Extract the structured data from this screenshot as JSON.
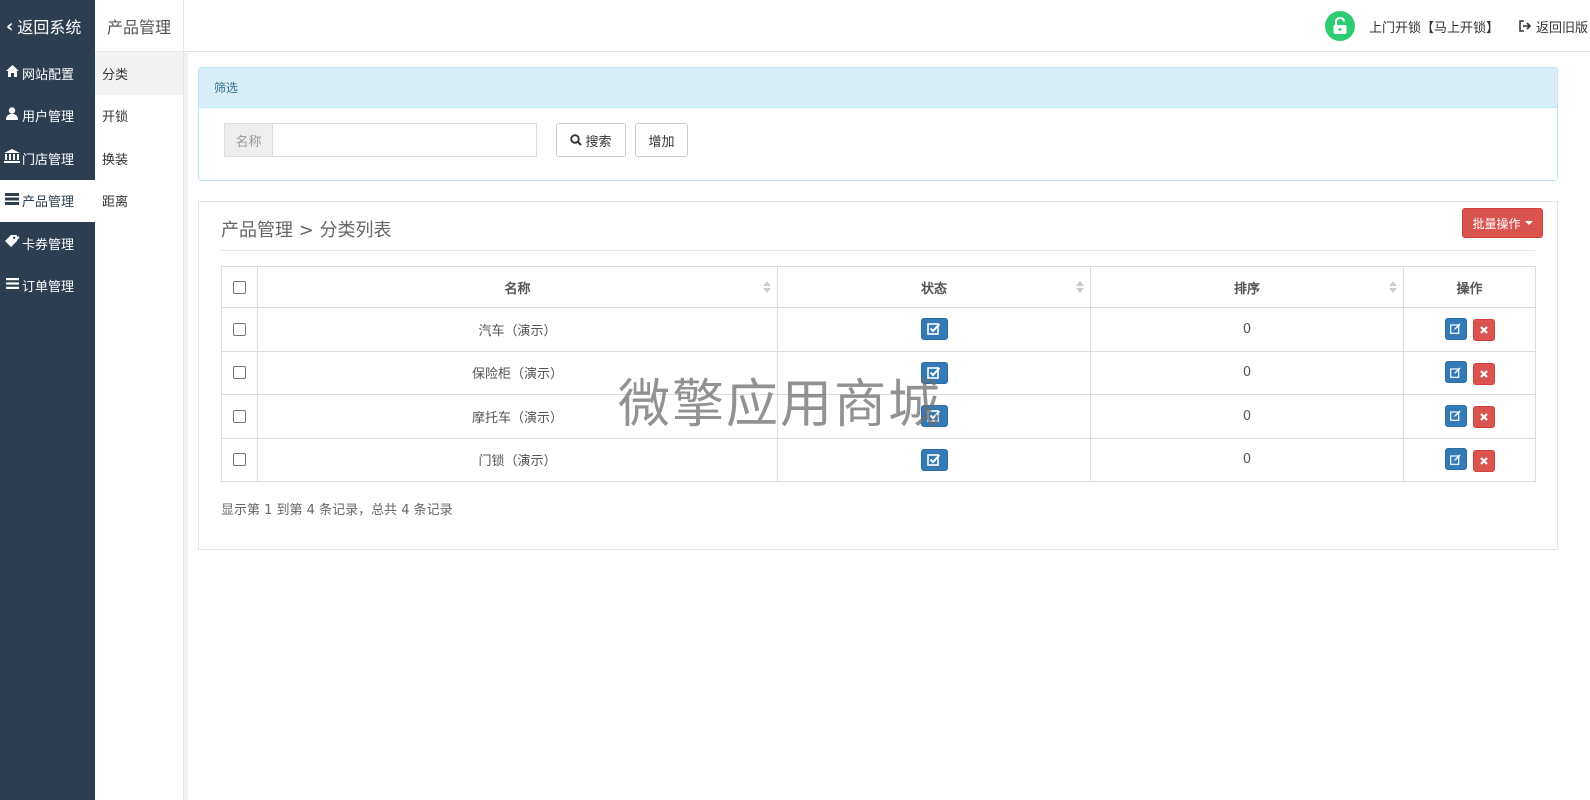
{
  "sidebar": {
    "back_label": "返回系统",
    "items": [
      {
        "label": "网站配置",
        "icon": "home-icon"
      },
      {
        "label": "用户管理",
        "icon": "user-icon"
      },
      {
        "label": "门店管理",
        "icon": "bank-icon"
      },
      {
        "label": "产品管理",
        "icon": "server-icon"
      },
      {
        "label": "卡券管理",
        "icon": "tags-icon"
      },
      {
        "label": "订单管理",
        "icon": "list-icon"
      }
    ]
  },
  "submenu": {
    "title": "产品管理",
    "items": [
      "分类",
      "开锁",
      "换装",
      "距离"
    ]
  },
  "header": {
    "unlock_link": "上门开锁【马上开锁】",
    "back_old": "返回旧版",
    "accent_color": "#2ecc71"
  },
  "filter": {
    "title": "筛选",
    "name_addon": "名称",
    "name_value": "",
    "search_label": "搜索",
    "add_label": "增加"
  },
  "list": {
    "breadcrumb": "产品管理 > 分类列表",
    "batch_label": "批量操作",
    "columns": [
      "名称",
      "状态",
      "排序",
      "操作"
    ],
    "rows": [
      {
        "name": "汽车（演示）",
        "sort": "0",
        "checked": true
      },
      {
        "name": "保险柜（演示）",
        "sort": "0",
        "checked": true
      },
      {
        "name": "摩托车（演示）",
        "sort": "0",
        "checked": true
      },
      {
        "name": "门锁（演示）",
        "sort": "0",
        "checked": true
      }
    ],
    "summary": "显示第 1 到第 4 条记录，总共 4 条记录"
  },
  "watermark": "微擎应用商城",
  "colors": {
    "sidebar_bg": "#2c3e50",
    "primary": "#337ab7",
    "danger": "#d9534f",
    "info_bg": "#d9edf7"
  }
}
